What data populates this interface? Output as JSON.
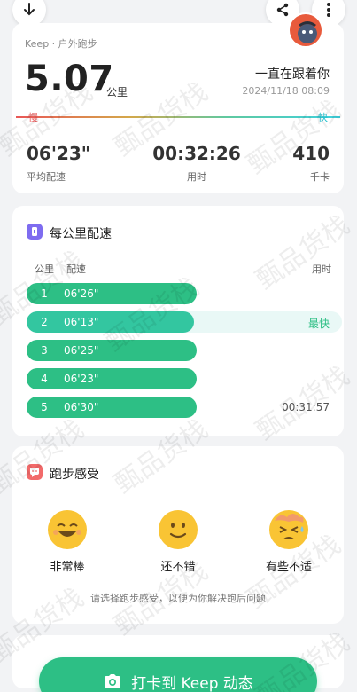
{
  "summary": {
    "sport_label": "Keep · 户外跑步",
    "distance": "5.07",
    "distance_unit": "公里",
    "motto": "一直在跟着你",
    "datetime": "2024/11/18 08:09",
    "slow_label": "慢",
    "fast_label": "快",
    "stats": [
      {
        "value": "06'23\"",
        "label": "平均配速"
      },
      {
        "value": "00:32:26",
        "label": "用时"
      },
      {
        "value": "410",
        "label": "千卡"
      }
    ]
  },
  "splits": {
    "title": "每公里配速",
    "col_km": "公里",
    "col_pace": "配速",
    "col_time": "用时",
    "fastest_tag": "最快",
    "total_time": "00:31:57",
    "rows": [
      {
        "km": "1",
        "pace": "06'26\"",
        "fill": 0.54
      },
      {
        "km": "2",
        "pace": "06'13\"",
        "fill": 0.53
      },
      {
        "km": "3",
        "pace": "06'25\"",
        "fill": 0.54
      },
      {
        "km": "4",
        "pace": "06'23\"",
        "fill": 0.54
      },
      {
        "km": "5",
        "pace": "06'30\"",
        "fill": 0.54
      }
    ]
  },
  "feeling": {
    "title": "跑步感受",
    "options": [
      {
        "label": "非常棒",
        "icon": "laughing-face-icon"
      },
      {
        "label": "还不错",
        "icon": "smiling-face-icon"
      },
      {
        "label": "有些不适",
        "icon": "sweating-distressed-face-icon"
      }
    ],
    "hint": "请选择跑步感受，以便为你解决跑后问题"
  },
  "checkin": {
    "label": "打卡到 Keep 动态",
    "icon": "camera-icon"
  },
  "watermark": "甄品货栈",
  "colors": {
    "accent": "#2dbf85",
    "fast_bg": "#e9f8f6",
    "face": "#f9c434"
  }
}
